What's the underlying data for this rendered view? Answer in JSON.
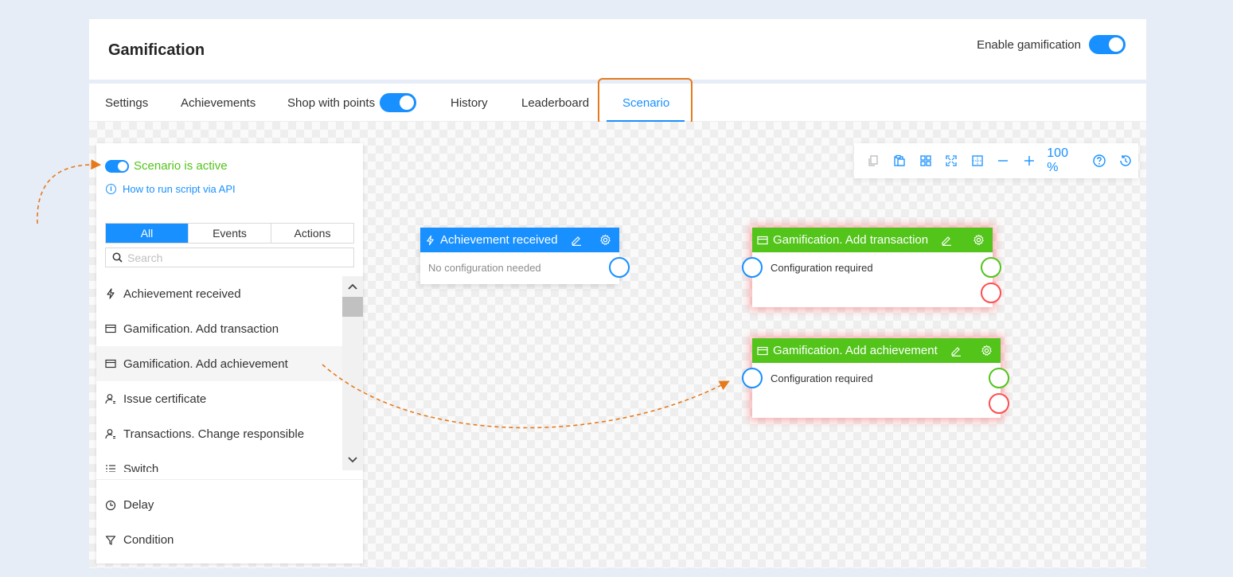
{
  "header": {
    "title": "Gamification",
    "enable_label": "Enable gamification"
  },
  "tabs": [
    {
      "label": "Settings"
    },
    {
      "label": "Achievements"
    },
    {
      "label": "Shop with points"
    },
    {
      "label": "History"
    },
    {
      "label": "Leaderboard"
    },
    {
      "label": "Scenario"
    }
  ],
  "sidebar": {
    "active_label": "Scenario is active",
    "api_link": "How to run script via API",
    "filters": [
      "All",
      "Events",
      "Actions"
    ],
    "search_placeholder": "Search",
    "items": [
      {
        "label": "Achievement received",
        "icon": "bolt-icon"
      },
      {
        "label": "Gamification. Add transaction",
        "icon": "card-icon"
      },
      {
        "label": "Gamification. Add achievement",
        "icon": "card-icon"
      },
      {
        "label": "Issue certificate",
        "icon": "user-icon"
      },
      {
        "label": "Transactions. Change responsible",
        "icon": "user-icon"
      },
      {
        "label": "Switch",
        "icon": "list-icon"
      }
    ],
    "bottom_items": [
      {
        "label": "Delay",
        "icon": "clock-icon"
      },
      {
        "label": "Condition",
        "icon": "filter-icon"
      }
    ]
  },
  "toolbar": {
    "zoom": "100 %"
  },
  "nodes": [
    {
      "title": "Achievement received",
      "body": "No configuration needed"
    },
    {
      "title": "Gamification. Add transaction",
      "body": "Configuration required"
    },
    {
      "title": "Gamification. Add achievement",
      "body": "Configuration required"
    }
  ],
  "colors": {
    "primary": "#1890ff",
    "success": "#52c41a",
    "error": "#ff4d4f",
    "highlight": "#e57a1c"
  }
}
